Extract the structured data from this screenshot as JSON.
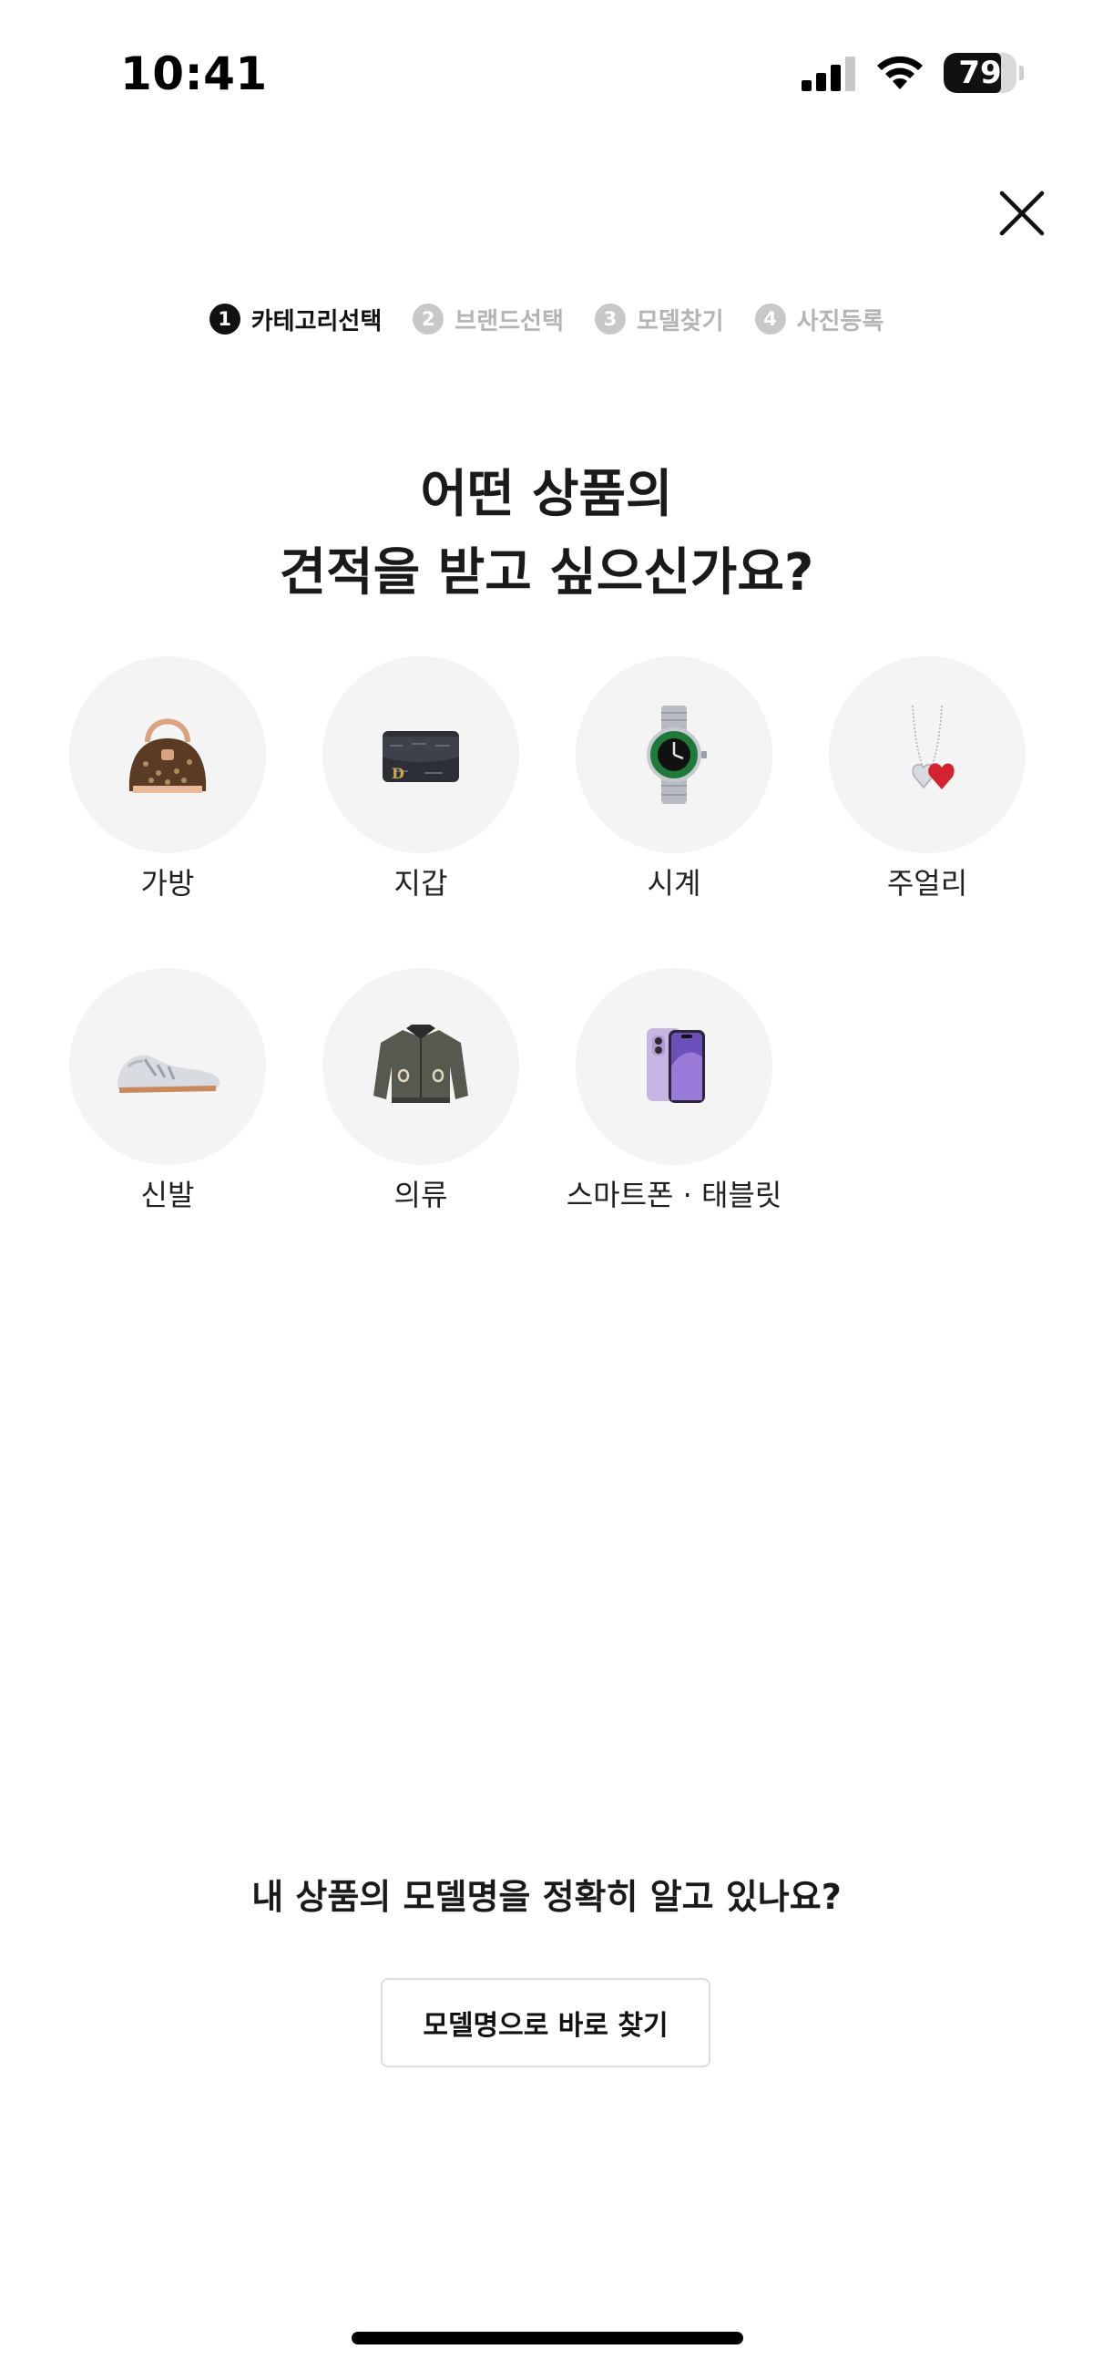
{
  "status_bar": {
    "time": "10:41",
    "battery_level": "79",
    "battery_fraction": 0.79
  },
  "stepper": {
    "steps": [
      {
        "number": "1",
        "label": "카테고리선택",
        "active": true
      },
      {
        "number": "2",
        "label": "브랜드선택",
        "active": false
      },
      {
        "number": "3",
        "label": "모델찾기",
        "active": false
      },
      {
        "number": "4",
        "label": "사진등록",
        "active": false
      }
    ]
  },
  "heading": {
    "line1": "어떤 상품의",
    "line2": "견적을 받고 싶으신가요?"
  },
  "categories": [
    {
      "label": "가방",
      "icon": "handbag-icon"
    },
    {
      "label": "지갑",
      "icon": "wallet-icon"
    },
    {
      "label": "시계",
      "icon": "watch-icon"
    },
    {
      "label": "주얼리",
      "icon": "necklace-icon"
    },
    {
      "label": "신발",
      "icon": "sneaker-icon"
    },
    {
      "label": "의류",
      "icon": "jacket-icon"
    },
    {
      "label": "스마트폰 · 태블릿",
      "icon": "smartphone-icon"
    }
  ],
  "model_search": {
    "prompt": "내 상품의 모델명을 정확히 알고 있나요?",
    "button_label": "모델명으로 바로 찾기"
  },
  "colors": {
    "accent": "#111111",
    "inactive": "#b4b4b4",
    "category_bg": "#f4f4f4",
    "background": "#ffffff"
  }
}
